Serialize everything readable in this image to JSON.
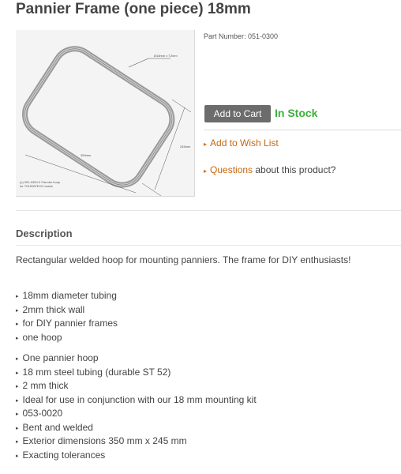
{
  "product": {
    "title": "Pannier Frame (one piece) 18mm",
    "part_number": "Part Number: 051-0300",
    "stock_status": "In Stock"
  },
  "image": {
    "dimension_tube": "Ø18mm x T2mm",
    "dimension_height": "245mm",
    "dimension_width": "350mm",
    "caption_line1": "(c) 051-0300-0 Pannier hoop",
    "caption_line2": "for TOURATECH cases"
  },
  "actions": {
    "add_to_cart": "Add to Cart",
    "wish_list": "Add to Wish List",
    "questions_link": "Questions",
    "questions_rest": " about this product?",
    "arrow_icon": "arrow-right-icon"
  },
  "description": {
    "heading": "Description",
    "text": "Rectangular welded hoop for mounting panniers. The frame for DIY enthusiasts!",
    "features_a": [
      "18mm diameter tubing",
      "2mm thick wall",
      "for DIY pannier frames",
      "one hoop"
    ],
    "features_b": [
      "One pannier hoop",
      "18 mm steel tubing (durable ST 52)",
      "2 mm thick",
      "Ideal for use in conjunction with our 18 mm mounting kit",
      "053-0020",
      "Bent and welded",
      "Exterior dimensions 350 mm x 245 mm",
      "Exacting tolerances"
    ]
  },
  "colors": {
    "stock_green": "#3bb13b",
    "link_orange": "#c8670f",
    "button_gray": "#6c6c6c"
  }
}
